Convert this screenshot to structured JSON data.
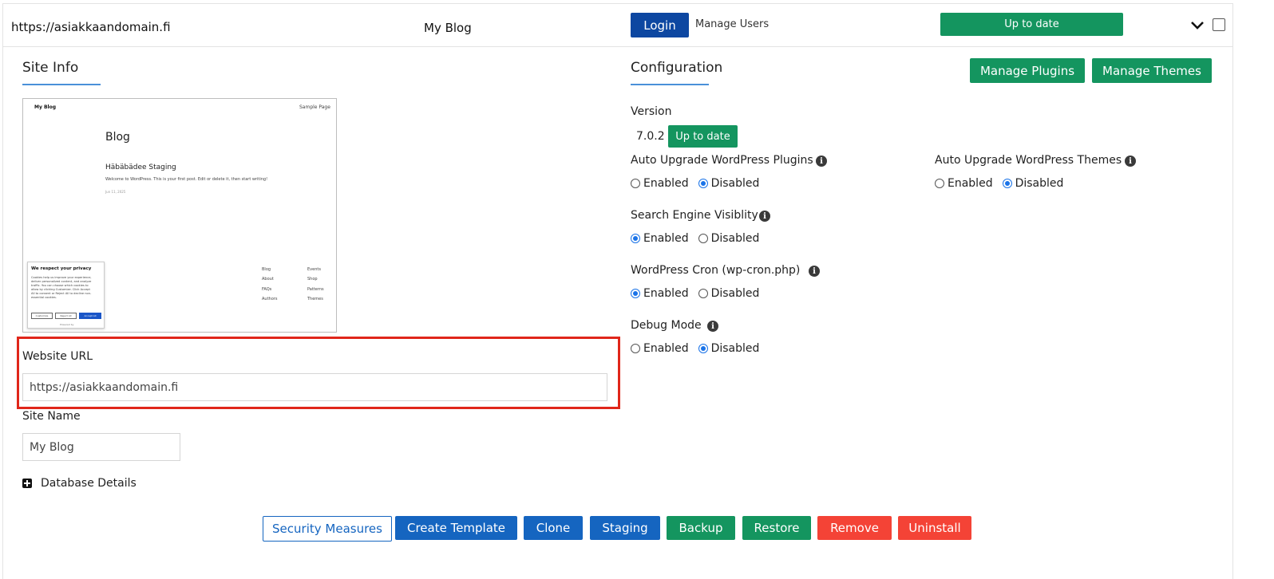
{
  "header": {
    "url": "https://asiakkaandomain.fi",
    "site_name": "My Blog",
    "login_label": "Login",
    "manage_users_label": "Manage Users",
    "status_label": "Up to date"
  },
  "site_info": {
    "title": "Site Info",
    "preview": {
      "site_title": "My Blog",
      "nav_link": "Sample Page",
      "page_heading": "Blog",
      "post_title": "Häbäbädee Staging",
      "post_excerpt": "Welcome to WordPress. This is your first post. Edit or delete it, then start writing!",
      "post_date": "Jun 11, 2025",
      "footer_col1": [
        "Blog",
        "About",
        "FAQs",
        "Authors"
      ],
      "footer_col2": [
        "Events",
        "Shop",
        "Patterns",
        "Themes"
      ],
      "cookie_title": "We respect your privacy",
      "cookie_text": [
        "Cookies help us improve your experience,",
        "deliver personalized content, and analyze",
        "traffic. You can choose which cookies to",
        "allow by clicking Customize. Click Accept",
        "All to consent or Reject All to decline non-",
        "essential cookies."
      ],
      "cookie_customize": "Customize",
      "cookie_reject": "Reject All",
      "cookie_accept": "Accept All",
      "cookie_powered": "Powered by"
    },
    "website_url_label": "Website URL",
    "website_url_value": "https://asiakkaandomain.fi",
    "site_name_label": "Site Name",
    "site_name_value": "My Blog",
    "database_details_label": "Database Details"
  },
  "configuration": {
    "title": "Configuration",
    "manage_plugins_label": "Manage Plugins",
    "manage_themes_label": "Manage Themes",
    "version_label": "Version",
    "version_value": "7.0.2",
    "version_status": "Up to date",
    "auto_upgrade_plugins_label": "Auto Upgrade WordPress Plugins",
    "auto_upgrade_themes_label": "Auto Upgrade WordPress Themes",
    "search_engine_label": "Search Engine Visiblity",
    "cron_label": "WordPress Cron (wp-cron.php)",
    "debug_label": "Debug Mode",
    "enabled_label": "Enabled",
    "disabled_label": "Disabled",
    "info_glyph": "i",
    "selected": {
      "auto_upgrade_plugins": "Disabled",
      "auto_upgrade_themes": "Disabled",
      "search_engine": "Enabled",
      "cron": "Enabled",
      "debug": "Disabled"
    }
  },
  "actions": {
    "security_measures": "Security Measures",
    "create_template": "Create Template",
    "clone": "Clone",
    "staging": "Staging",
    "backup": "Backup",
    "restore": "Restore",
    "remove": "Remove",
    "uninstall": "Uninstall"
  }
}
